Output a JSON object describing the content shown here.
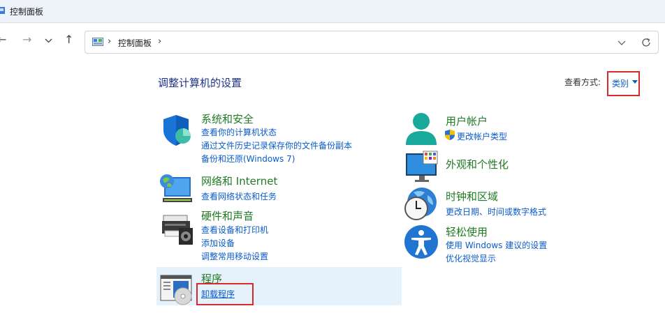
{
  "window": {
    "title": "控制面板"
  },
  "nav": {
    "back_glyph": "←",
    "forward_glyph": "→",
    "recent_glyph": "⌄",
    "up_glyph": "↑"
  },
  "address": {
    "separator": "›",
    "crumb": "控制面板"
  },
  "page": {
    "title": "调整计算机的设置"
  },
  "view": {
    "label": "查看方式:",
    "mode": "类别"
  },
  "categories": {
    "system": {
      "title": "系统和安全",
      "links": [
        "查看你的计算机状态",
        "通过文件历史记录保存你的文件备份副本",
        "备份和还原(Windows 7)"
      ]
    },
    "network": {
      "title": "网络和 Internet",
      "links": [
        "查看网络状态和任务"
      ]
    },
    "hardware": {
      "title": "硬件和声音",
      "links": [
        "查看设备和打印机",
        "添加设备",
        "调整常用移动设置"
      ]
    },
    "programs": {
      "title": "程序",
      "links": [
        "卸载程序"
      ]
    },
    "user": {
      "title": "用户帐户",
      "links": [
        "更改帐户类型"
      ]
    },
    "appearance": {
      "title": "外观和个性化",
      "links": []
    },
    "clock": {
      "title": "时钟和区域",
      "links": [
        "更改日期、时间或数字格式"
      ]
    },
    "ease": {
      "title": "轻松使用",
      "links": [
        "使用 Windows 建议的设置",
        "优化视觉显示"
      ]
    }
  },
  "colors": {
    "heading": "#1f7a22",
    "link": "#0a5ccb",
    "title": "#1e3287",
    "highlight_border": "#d52b2b",
    "hover_bg": "#e5f1fb"
  }
}
